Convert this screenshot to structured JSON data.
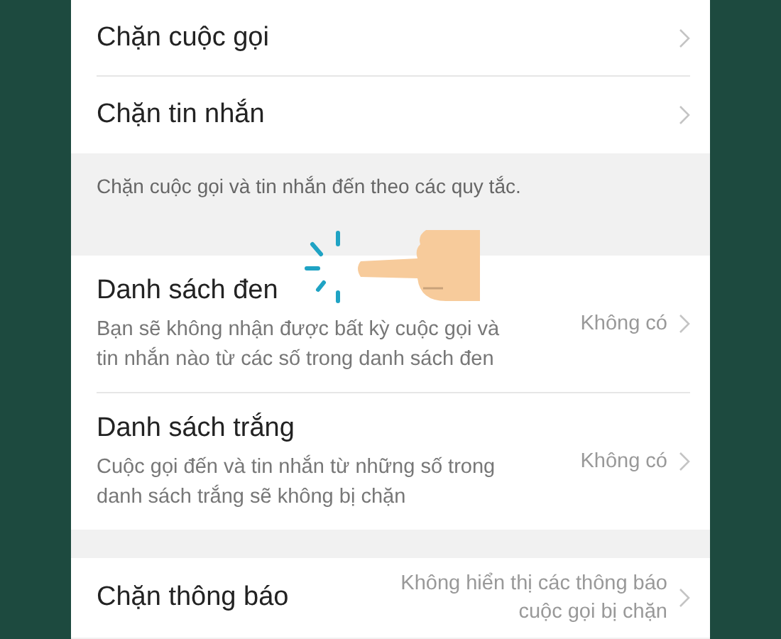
{
  "sections": [
    {
      "kind": "group",
      "items": [
        {
          "title": "Chặn cuộc gọi"
        },
        {
          "title": "Chặn tin nhắn"
        }
      ]
    },
    {
      "kind": "note",
      "text": "Chặn cuộc gọi và tin nhắn đến theo các quy tắc."
    },
    {
      "kind": "group",
      "items": [
        {
          "title": "Danh sách đen",
          "subtitle": "Bạn sẽ không nhận được bất kỳ cuộc gọi và tin nhắn nào từ các số trong danh sách đen",
          "value": "Không có"
        },
        {
          "title": "Danh sách trắng",
          "subtitle": "Cuộc gọi đến và tin nhắn từ những số trong danh sách trắng sẽ không bị chặn",
          "value": "Không có"
        }
      ]
    },
    {
      "kind": "spacer"
    },
    {
      "kind": "group",
      "items": [
        {
          "title": "Chặn thông báo",
          "value": "Không hiển thị các thông báo cuộc gọi bị chặn"
        }
      ]
    }
  ]
}
